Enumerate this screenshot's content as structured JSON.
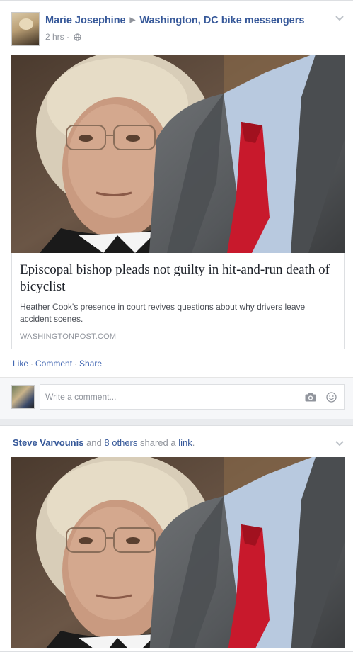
{
  "post1": {
    "author": "Marie Josephine",
    "group": "Washington, DC bike messengers",
    "time": "2 hrs",
    "meta_sep": "·",
    "link": {
      "title": "Episcopal bishop pleads not guilty in hit-and-run death of bicyclist",
      "description": "Heather Cook's presence in court revives questions about why drivers leave accident scenes.",
      "source": "WASHINGTONPOST.COM"
    },
    "actions": {
      "like": "Like",
      "comment": "Comment",
      "share": "Share",
      "sep": "·"
    },
    "comment_placeholder": "Write a comment..."
  },
  "post2": {
    "sharer": "Steve Varvounis",
    "and": "and",
    "others": "8 others",
    "shared_a": "shared a",
    "link_word": "link",
    "period": "."
  },
  "icons": {
    "chevron": "chevron-down-icon",
    "arrow": "triangle-right-icon",
    "globe": "globe-icon",
    "camera": "camera-icon",
    "emoji": "smiley-icon"
  },
  "colors": {
    "link_blue": "#365899",
    "meta_gray": "#90949c",
    "background": "#e9ebee",
    "tie_red": "#c8192c"
  }
}
